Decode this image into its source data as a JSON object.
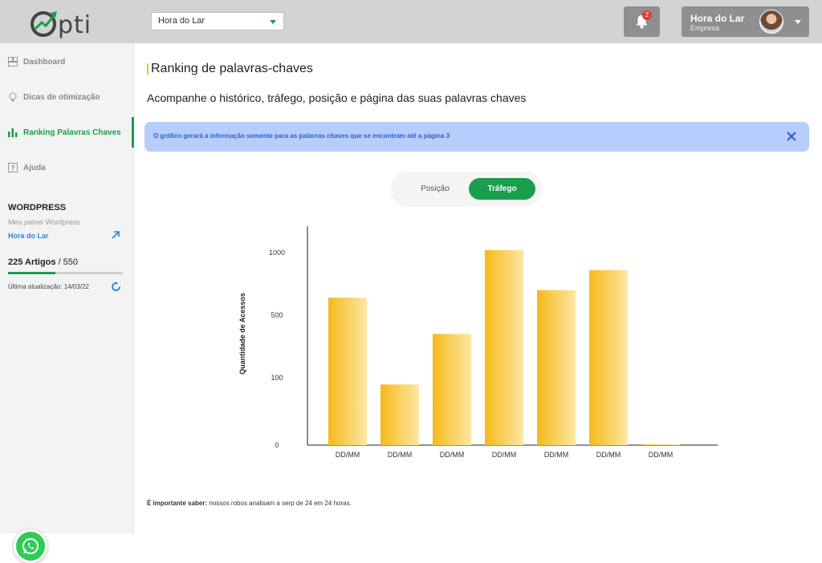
{
  "header": {
    "logo_text": "pti",
    "site_select": "Hora do Lar",
    "notification_count": "2",
    "user_name": "Hora do Lar",
    "user_role": "Empresa"
  },
  "sidebar": {
    "items": [
      {
        "label": "Dashboard",
        "icon": "dashboard-icon"
      },
      {
        "label": "Dicas de otimização",
        "icon": "lightbulb-icon"
      },
      {
        "label": "Ranking Palavras Chaves",
        "icon": "bar-chart-icon"
      },
      {
        "label": "Ajuda",
        "icon": "help-icon"
      }
    ],
    "wp_title": "WORDPRESS",
    "wp_sub": "Meu painel Wordpress",
    "wp_link": "Hora do Lar",
    "articles_count": "225 Artigos",
    "articles_total": " / 550",
    "articles_progress": 0.41,
    "last_update": "Última atualização: 14/03/22"
  },
  "main": {
    "title": "Ranking de palavras-chaves",
    "subtitle": "Acompanhe o histórico, tráfego, posição e página das suas palavras chaves",
    "alert": "O gráfico gerará a informação somente para as palavras chaves que se encontram até a página 3",
    "toggle": {
      "posicao": "Posição",
      "trafego": "Tráfego",
      "selected": "Tráfego"
    },
    "footer_bold": "É importante saber:",
    "footer_text": " nossos robos analisam a serp de 24 em 24 horas."
  },
  "colors": {
    "accent": "#1a9e4b",
    "bar_start": "#f6b918",
    "bar_end": "#fde7a6",
    "alert_bg": "#b7cdfb"
  },
  "chart_data": {
    "type": "bar",
    "ylabel": "Quantidade de Acessos",
    "categories": [
      "DD/MM",
      "DD/MM",
      "DD/MM",
      "DD/MM",
      "DD/MM",
      "DD/MM",
      "DD/MM"
    ],
    "values": [
      640,
      90,
      380,
      1040,
      700,
      860,
      0
    ],
    "yticks": [
      "0",
      "100",
      "500",
      "1000"
    ]
  }
}
